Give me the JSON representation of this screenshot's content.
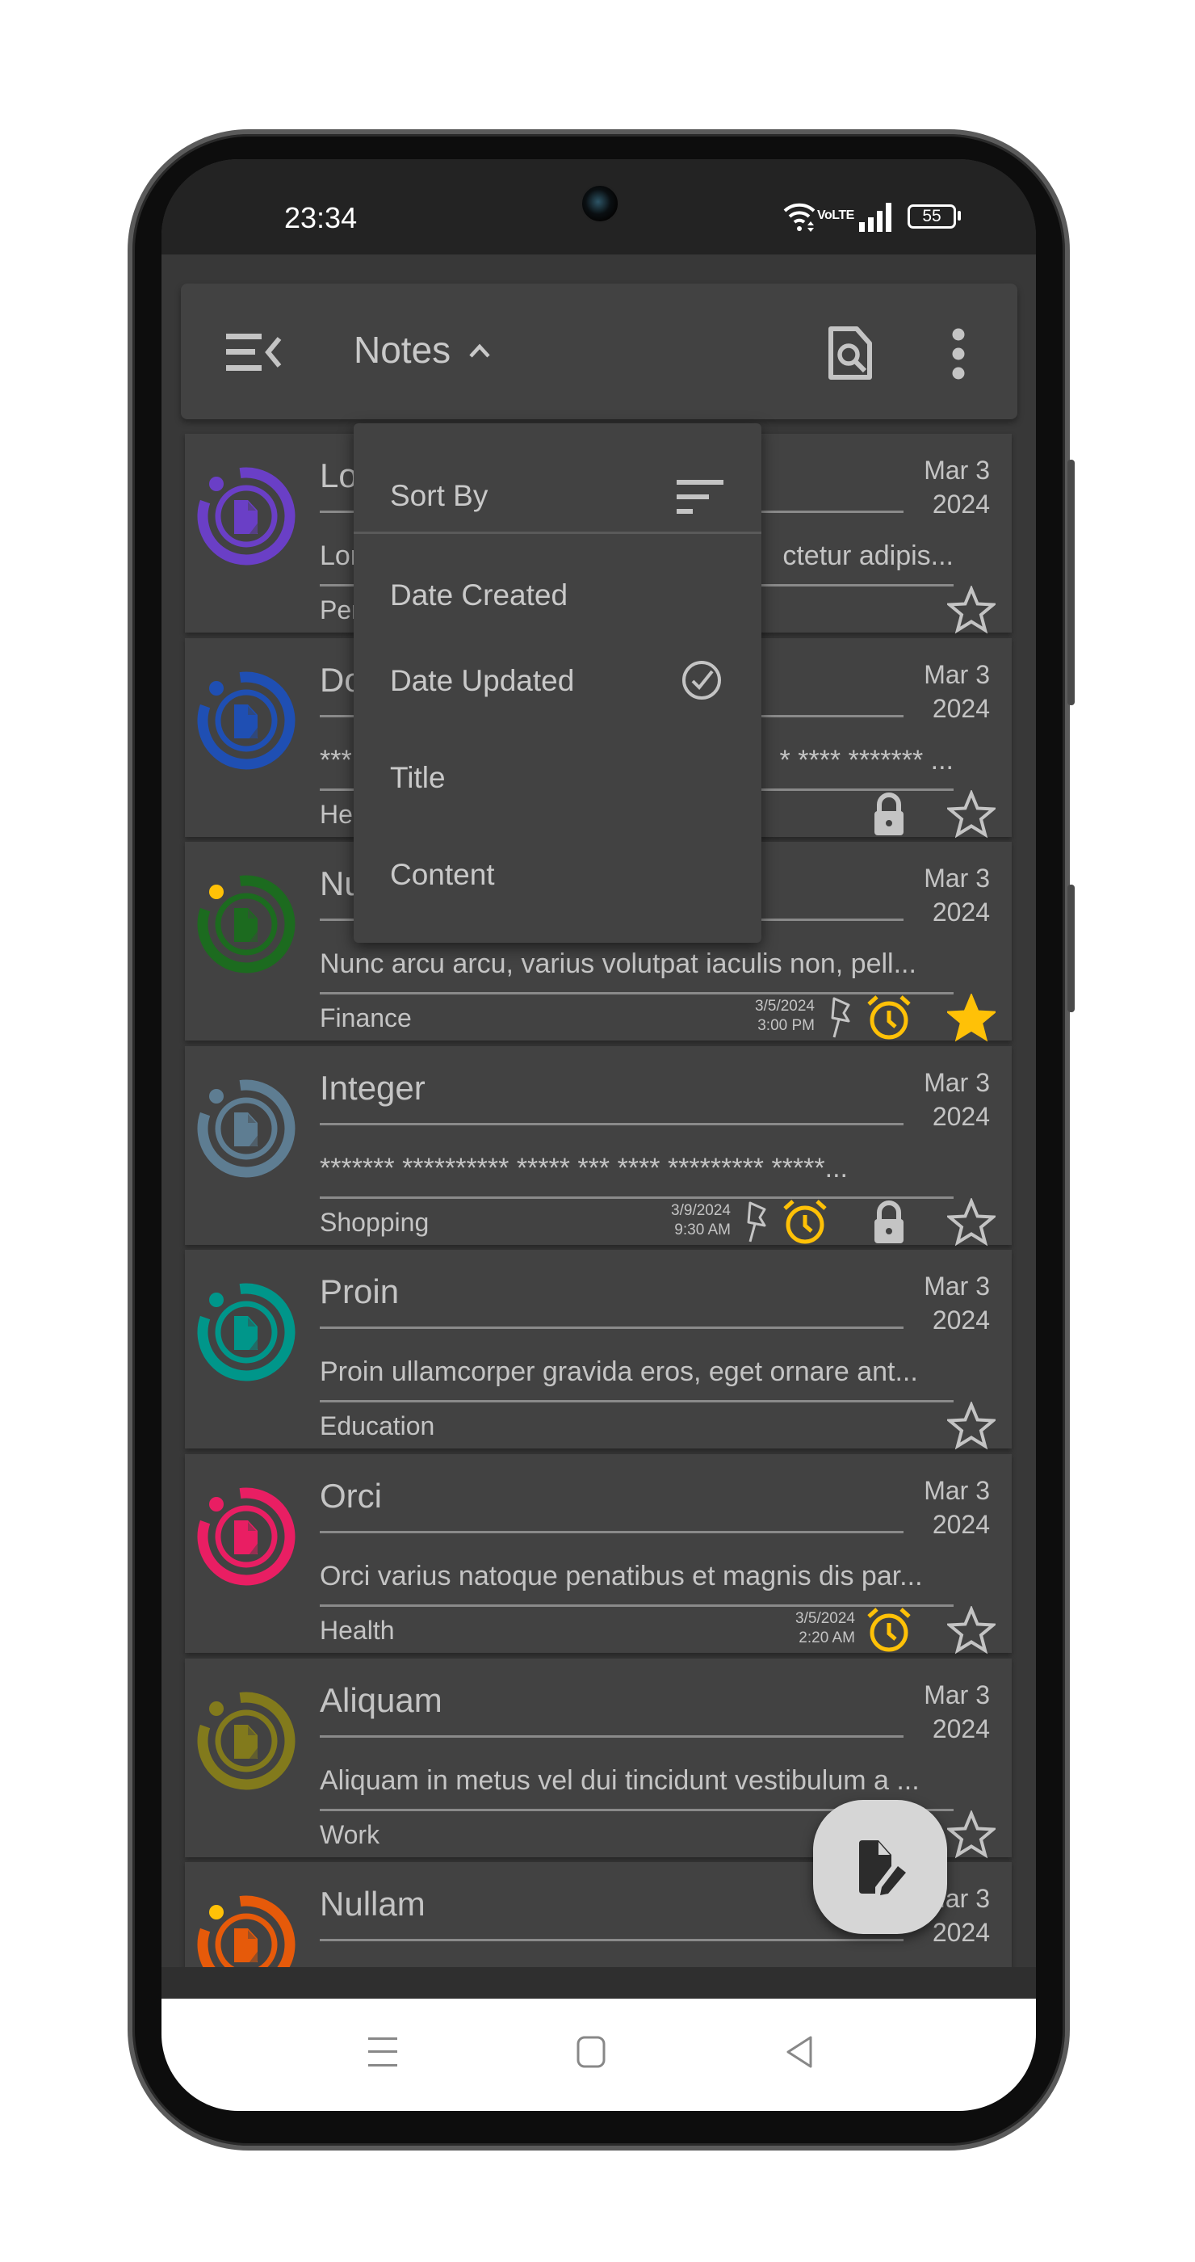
{
  "status_bar": {
    "time": "23:34",
    "battery": "55",
    "network": "VoLTE"
  },
  "app_bar": {
    "title": "Notes",
    "icons": [
      "menu-collapse-icon",
      "chevron-up-icon",
      "document-search-icon",
      "more-vertical-icon"
    ]
  },
  "sort_menu": {
    "header": "Sort By",
    "items": [
      {
        "label": "Date Created",
        "selected": false
      },
      {
        "label": "Date Updated",
        "selected": true
      },
      {
        "label": "Title",
        "selected": false
      },
      {
        "label": "Content",
        "selected": false
      }
    ]
  },
  "colors": {
    "accent_yellow": "#ffc107",
    "card_bg": "#424242",
    "text": "#c4c4c4"
  },
  "notes": [
    {
      "title": "Lo",
      "date_line1": "Mar 3",
      "date_line2": "2024",
      "content": "Lor",
      "content_right": "ctetur adipis...",
      "category": "Per",
      "color": "#6a3fc6",
      "dot_color": "#6a3fc6",
      "starred": false,
      "locked": false,
      "pinned": false,
      "reminder": null
    },
    {
      "title": "Do",
      "date_line1": "Mar 3",
      "date_line2": "2024",
      "content": "***",
      "content_right": "* **** ******* ...",
      "category": "Hea",
      "color": "#1f4fb3",
      "dot_color": "#1f4fb3",
      "starred": false,
      "locked": true,
      "pinned": false,
      "reminder": null
    },
    {
      "title": "Nu",
      "date_line1": "Mar 3",
      "date_line2": "2024",
      "content": "Nunc arcu arcu, varius volutpat iaculis non, pell...",
      "category": "Finance",
      "color": "#1c6b1f",
      "dot_color": "#ffc107",
      "starred": true,
      "locked": false,
      "pinned": true,
      "reminder": {
        "date": "3/5/2024",
        "time": "3:00 PM"
      }
    },
    {
      "title": "Integer",
      "date_line1": "Mar 3",
      "date_line2": "2024",
      "content": "******* ********** ***** *** **** ********* *****...",
      "category": "Shopping",
      "color": "#5e7d92",
      "dot_color": "#5e7d92",
      "starred": false,
      "locked": true,
      "pinned": true,
      "reminder": {
        "date": "3/9/2024",
        "time": "9:30 AM"
      }
    },
    {
      "title": "Proin",
      "date_line1": "Mar 3",
      "date_line2": "2024",
      "content": "Proin ullamcorper gravida eros, eget ornare ant...",
      "category": "Education",
      "color": "#00968a",
      "dot_color": "#00968a",
      "starred": false,
      "locked": false,
      "pinned": false,
      "reminder": null
    },
    {
      "title": "Orci",
      "date_line1": "Mar 3",
      "date_line2": "2024",
      "content": "Orci varius natoque penatibus et magnis dis par...",
      "category": "Health",
      "color": "#e91e63",
      "dot_color": "#e91e63",
      "starred": false,
      "locked": false,
      "pinned": false,
      "reminder": {
        "date": "3/5/2024",
        "time": "2:20 AM"
      }
    },
    {
      "title": "Aliquam",
      "date_line1": "Mar 3",
      "date_line2": "2024",
      "content": "Aliquam in metus vel dui tincidunt vestibulum a ...",
      "category": "Work",
      "color": "#827a1c",
      "dot_color": "#827a1c",
      "starred": false,
      "locked": false,
      "pinned": false,
      "reminder": null
    },
    {
      "title": "Nullam",
      "date_line1": "Mar 3",
      "date_line2": "2024",
      "content": "",
      "category": "",
      "color": "#e65a0a",
      "dot_color": "#ffc107",
      "starred": false,
      "locked": false,
      "pinned": false,
      "reminder": null
    }
  ],
  "fab": {
    "icon": "new-note-icon"
  },
  "nav_bar": {
    "icons": [
      "recents-icon",
      "home-icon",
      "back-icon"
    ]
  }
}
